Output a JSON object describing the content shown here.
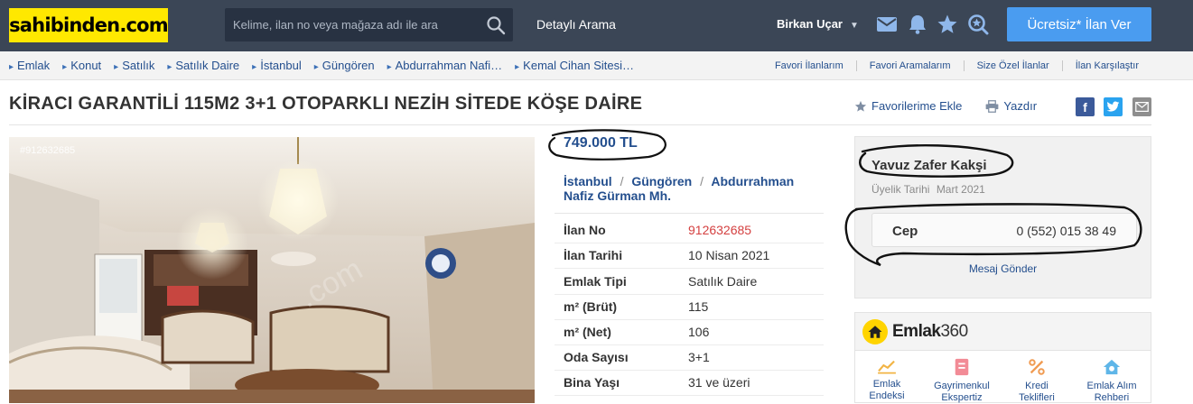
{
  "header": {
    "logo_text": "sahibinden.com",
    "search_placeholder": "Kelime, ilan no veya mağaza adı ile ara",
    "detailed_search": "Detaylı Arama",
    "user_name": "Birkan Uçar",
    "cta_label": "Ücretsiz* İlan Ver",
    "icons": [
      "envelope-icon",
      "bell-icon",
      "star-icon",
      "saved-search-icon",
      "search-icon"
    ]
  },
  "breadcrumb": {
    "items": [
      "Emlak",
      "Konut",
      "Satılık",
      "Satılık Daire",
      "İstanbul",
      "Güngören",
      "Abdurrahman Nafi…",
      "Kemal Cihan Sitesi…"
    ],
    "quick_links": [
      "Favori İlanlarım",
      "Favori Aramalarım",
      "Size Özel İlanlar",
      "İlan Karşılaştır"
    ]
  },
  "listing": {
    "title": "KİRACI GARANTİLİ 115M2 3+1 OTOPARKLI NEZİH SİTEDE KÖŞE DAİRE",
    "add_favorite": "Favorilerime Ekle",
    "print": "Yazdır",
    "photo_id": "#912632685",
    "price": "749.000 TL",
    "location": {
      "city": "İstanbul",
      "district": "Güngören",
      "neighborhood": "Abdurrahman Nafiz Gürman Mh.",
      "separator": "/"
    },
    "details": [
      {
        "label": "İlan No",
        "value": "912632685"
      },
      {
        "label": "İlan Tarihi",
        "value": "10 Nisan 2021"
      },
      {
        "label": "Emlak Tipi",
        "value": "Satılık Daire"
      },
      {
        "label": "m² (Brüt)",
        "value": "115"
      },
      {
        "label": "m² (Net)",
        "value": "106"
      },
      {
        "label": "Oda Sayısı",
        "value": "3+1"
      },
      {
        "label": "Bina Yaşı",
        "value": "31 ve üzeri"
      }
    ]
  },
  "seller": {
    "name": "Yavuz Zafer Kakşi",
    "membership_label": "Üyelik Tarihi",
    "membership_date": "Mart 2021",
    "phone_label": "Cep",
    "phone_number": "0 (552) 015 38 49",
    "message_label": "Mesaj Gönder"
  },
  "emlak360": {
    "brand_a": "Emlak",
    "brand_b": "360",
    "tools": [
      {
        "line1": "Emlak",
        "line2": "Endeksi",
        "icon": "chart-icon"
      },
      {
        "line1": "Gayrimenkul",
        "line2": "Ekspertiz",
        "icon": "document-icon"
      },
      {
        "line1": "Kredi",
        "line2": "Teklifleri",
        "icon": "percent-icon"
      },
      {
        "line1": "Emlak Alım",
        "line2": "Rehberi",
        "icon": "house-info-icon"
      }
    ]
  },
  "colors": {
    "header_bg": "#3b4656",
    "logo_bg": "#ffe800",
    "cta_bg": "#4a9cf0",
    "link": "#244f8e",
    "listing_no": "#d43f3f"
  }
}
